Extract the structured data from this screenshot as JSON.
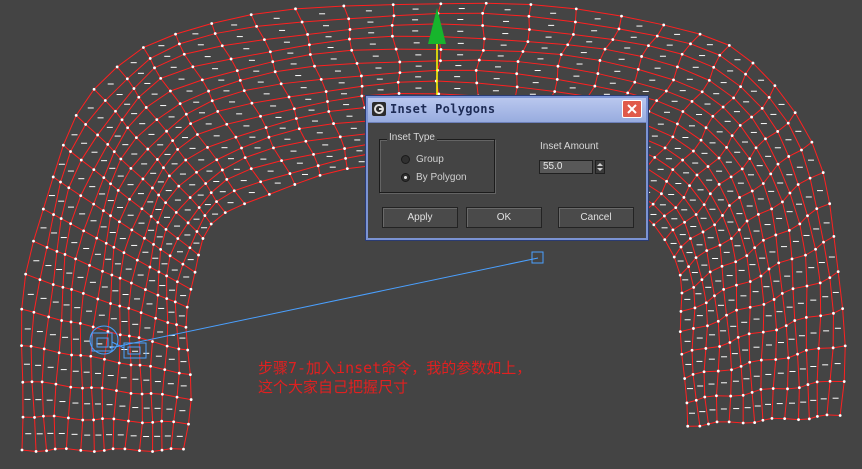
{
  "dialog": {
    "title": "Inset Polygons",
    "inset_type_label": "Inset Type",
    "options": [
      "Group",
      "By Polygon"
    ],
    "selected_option": "By Polygon",
    "inset_amount_label": "Inset Amount",
    "inset_amount_value": "55.0",
    "buttons": {
      "apply": "Apply",
      "ok": "OK",
      "cancel": "Cancel"
    }
  },
  "caption": {
    "line1": "步骤7-加入inset命令，我的参数如上，",
    "line2": "这个大家自己把握尺寸"
  },
  "colors": {
    "viewport_bg": "#444444",
    "edge_red": "#ff2020",
    "vertex_white": "#ffffff",
    "gizmo_green": "#17b52c",
    "gizmo_yellow": "#ffff00",
    "light_line": "#4aa0ff",
    "dialog_border": "#7b93d3",
    "caption_red": "#e02020"
  }
}
